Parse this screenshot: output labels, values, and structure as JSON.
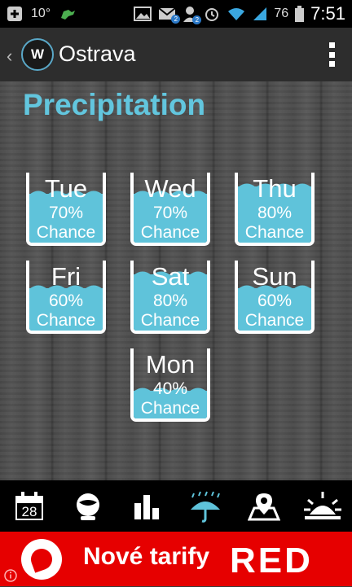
{
  "statusbar": {
    "temp": "10°",
    "battery": "76",
    "time": "7:51",
    "gmail_badge": "2",
    "other_badge": "2"
  },
  "actionbar": {
    "logo_text": "W",
    "title": "Ostrava"
  },
  "heading": "Precipitation",
  "days": [
    {
      "day": "Tue",
      "percent": "70%",
      "chance": "Chance",
      "level": 0.7
    },
    {
      "day": "Wed",
      "percent": "70%",
      "chance": "Chance",
      "level": 0.7
    },
    {
      "day": "Thu",
      "percent": "80%",
      "chance": "Chance",
      "level": 0.8
    },
    {
      "day": "Fri",
      "percent": "60%",
      "chance": "Chance",
      "level": 0.6
    },
    {
      "day": "Sat",
      "percent": "80%",
      "chance": "Chance",
      "level": 0.8
    },
    {
      "day": "Sun",
      "percent": "60%",
      "chance": "Chance",
      "level": 0.6
    },
    {
      "day": "Mon",
      "percent": "40%",
      "chance": "Chance",
      "level": 0.4
    }
  ],
  "bottomnav": {
    "calendar_day": "28",
    "items": [
      "calendar-icon",
      "forecast-globe-icon",
      "chart-icon",
      "umbrella-icon",
      "map-icon",
      "sunrise-icon"
    ]
  },
  "ad": {
    "text": "Nové tarify",
    "brand": "RED"
  },
  "colors": {
    "accent": "#62c6de",
    "water": "#5fc3da",
    "ad_red": "#e60000"
  }
}
